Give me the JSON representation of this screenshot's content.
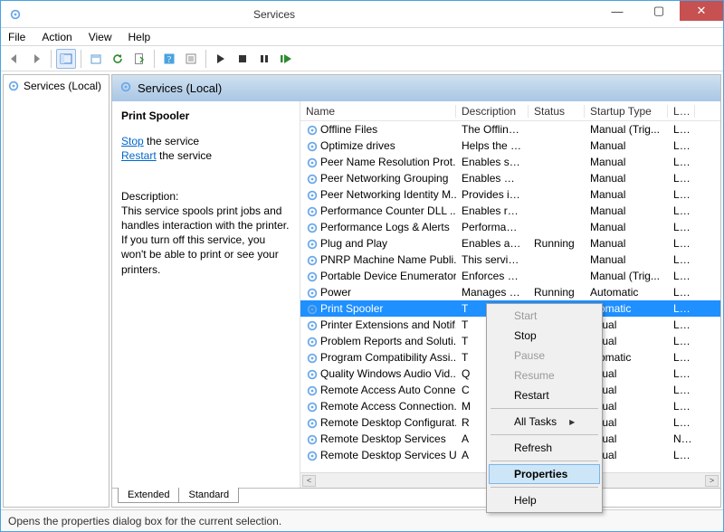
{
  "window": {
    "title": "Services"
  },
  "menus": {
    "file": "File",
    "action": "Action",
    "view": "View",
    "help": "Help"
  },
  "tree": {
    "root_label": "Services (Local)"
  },
  "header": {
    "label": "Services (Local)"
  },
  "detail": {
    "service_name": "Print Spooler",
    "stop_link": "Stop",
    "stop_suffix": " the service",
    "restart_link": "Restart",
    "restart_suffix": " the service",
    "desc_label": "Description:",
    "desc_body": "This service spools print jobs and handles interaction with the printer. If you turn off this service, you won't be able to print or see your printers."
  },
  "columns": {
    "name": "Name",
    "description": "Description",
    "status": "Status",
    "startup": "Startup Type",
    "logon": "Log"
  },
  "services": [
    {
      "name": "Offline Files",
      "desc": "The Offline ...",
      "status": "",
      "startup": "Manual (Trig...",
      "logon": "Loc"
    },
    {
      "name": "Optimize drives",
      "desc": "Helps the c...",
      "status": "",
      "startup": "Manual",
      "logon": "Loc"
    },
    {
      "name": "Peer Name Resolution Prot...",
      "desc": "Enables serv...",
      "status": "",
      "startup": "Manual",
      "logon": "Loc"
    },
    {
      "name": "Peer Networking Grouping",
      "desc": "Enables mul...",
      "status": "",
      "startup": "Manual",
      "logon": "Loc"
    },
    {
      "name": "Peer Networking Identity M...",
      "desc": "Provides ide...",
      "status": "",
      "startup": "Manual",
      "logon": "Loc"
    },
    {
      "name": "Performance Counter DLL ...",
      "desc": "Enables rem...",
      "status": "",
      "startup": "Manual",
      "logon": "Loc"
    },
    {
      "name": "Performance Logs & Alerts",
      "desc": "Performanc...",
      "status": "",
      "startup": "Manual",
      "logon": "Loc"
    },
    {
      "name": "Plug and Play",
      "desc": "Enables a c...",
      "status": "Running",
      "startup": "Manual",
      "logon": "Loc"
    },
    {
      "name": "PNRP Machine Name Publi...",
      "desc": "This service ...",
      "status": "",
      "startup": "Manual",
      "logon": "Loc"
    },
    {
      "name": "Portable Device Enumerator...",
      "desc": "Enforces gr...",
      "status": "",
      "startup": "Manual (Trig...",
      "logon": "Loc"
    },
    {
      "name": "Power",
      "desc": "Manages p...",
      "status": "Running",
      "startup": "Automatic",
      "logon": "Loc"
    },
    {
      "name": "Print Spooler",
      "desc": "T",
      "status": "",
      "startup": "utomatic",
      "logon": "Loc",
      "selected": true
    },
    {
      "name": "Printer Extensions and Notif...",
      "desc": "T",
      "status": "",
      "startup": "anual",
      "logon": "Loc"
    },
    {
      "name": "Problem Reports and Soluti...",
      "desc": "T",
      "status": "",
      "startup": "anual",
      "logon": "Loc"
    },
    {
      "name": "Program Compatibility Assi...",
      "desc": "T",
      "status": "",
      "startup": "utomatic",
      "logon": "Loc"
    },
    {
      "name": "Quality Windows Audio Vid...",
      "desc": "Q",
      "status": "",
      "startup": "anual",
      "logon": "Loc"
    },
    {
      "name": "Remote Access Auto Conne...",
      "desc": "C",
      "status": "",
      "startup": "anual",
      "logon": "Loc"
    },
    {
      "name": "Remote Access Connection...",
      "desc": "M",
      "status": "",
      "startup": "anual",
      "logon": "Loc"
    },
    {
      "name": "Remote Desktop Configurat...",
      "desc": "R",
      "status": "",
      "startup": "anual",
      "logon": "Loc"
    },
    {
      "name": "Remote Desktop Services",
      "desc": "A",
      "status": "",
      "startup": "anual",
      "logon": "Net"
    },
    {
      "name": "Remote Desktop Services U...",
      "desc": "A",
      "status": "",
      "startup": "anual",
      "logon": "Loc"
    }
  ],
  "context_menu": {
    "start": "Start",
    "stop": "Stop",
    "pause": "Pause",
    "resume": "Resume",
    "restart": "Restart",
    "all_tasks": "All Tasks",
    "refresh": "Refresh",
    "properties": "Properties",
    "help": "Help"
  },
  "tabs": {
    "extended": "Extended",
    "standard": "Standard"
  },
  "statusbar": "Opens the properties dialog box for the current selection."
}
